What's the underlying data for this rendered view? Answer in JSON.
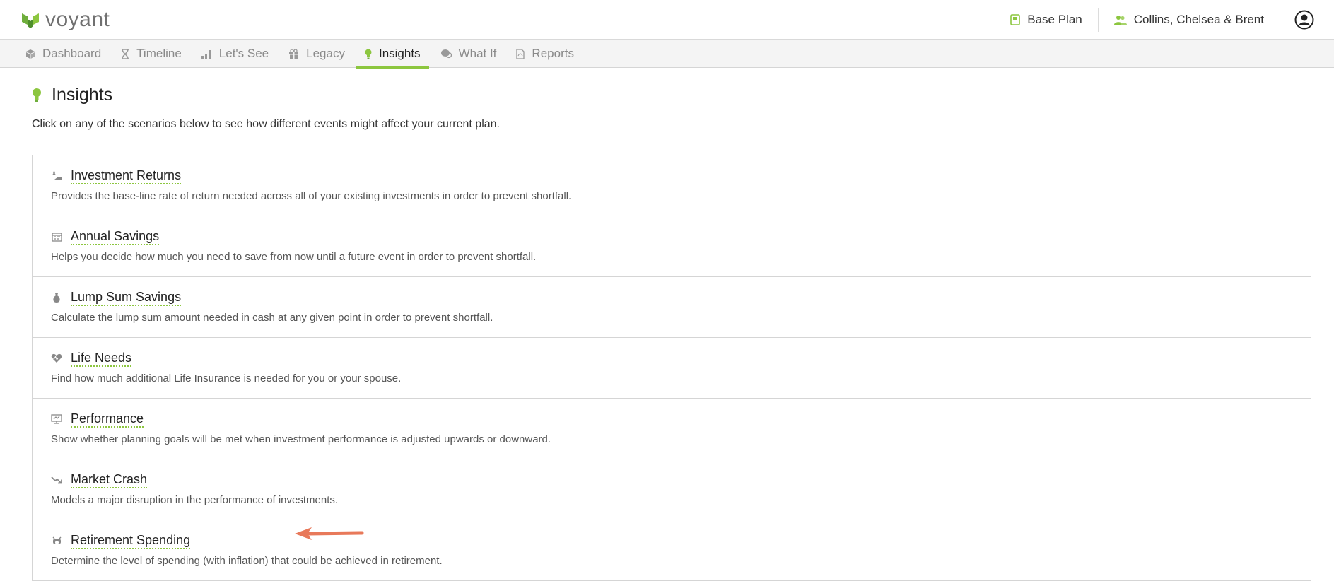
{
  "brand": {
    "name": "voyant",
    "accent": "#8cc63f"
  },
  "header": {
    "plan_label": "Base Plan",
    "clients_label": "Collins, Chelsea & Brent"
  },
  "nav": {
    "tabs": [
      {
        "label": "Dashboard",
        "icon": "cube-icon"
      },
      {
        "label": "Timeline",
        "icon": "hourglass-icon"
      },
      {
        "label": "Let's See",
        "icon": "bar-chart-icon"
      },
      {
        "label": "Legacy",
        "icon": "gift-icon"
      },
      {
        "label": "Insights",
        "icon": "lightbulb-icon",
        "active": true
      },
      {
        "label": "What If",
        "icon": "chat-icon"
      },
      {
        "label": "Reports",
        "icon": "pdf-file-icon"
      }
    ]
  },
  "main": {
    "title": "Insights",
    "description": "Click on any of the scenarios below to see how different events might affect your current plan.",
    "scenarios": [
      {
        "title": "Investment Returns",
        "icon": "hand-coin-icon",
        "description": "Provides the base-line rate of return needed across all of your existing investments in order to prevent shortfall."
      },
      {
        "title": "Annual Savings",
        "icon": "calendar-icon",
        "description": "Helps you decide how much you need to save from now until a future event in order to prevent shortfall."
      },
      {
        "title": "Lump Sum Savings",
        "icon": "money-bag-icon",
        "description": "Calculate the lump sum amount needed in cash at any given point in order to prevent shortfall."
      },
      {
        "title": "Life Needs",
        "icon": "heartbeat-icon",
        "description": "Find how much additional Life Insurance is needed for you or your spouse."
      },
      {
        "title": "Performance",
        "icon": "presentation-icon",
        "description": "Show whether planning goals will be met when investment performance is adjusted upwards or downward."
      },
      {
        "title": "Market Crash",
        "icon": "trend-down-icon",
        "description": "Models a major disruption in the performance of investments."
      },
      {
        "title": "Retirement Spending",
        "icon": "piggy-bank-icon",
        "description": "Determine the level of spending (with inflation) that could be achieved in retirement."
      }
    ]
  }
}
